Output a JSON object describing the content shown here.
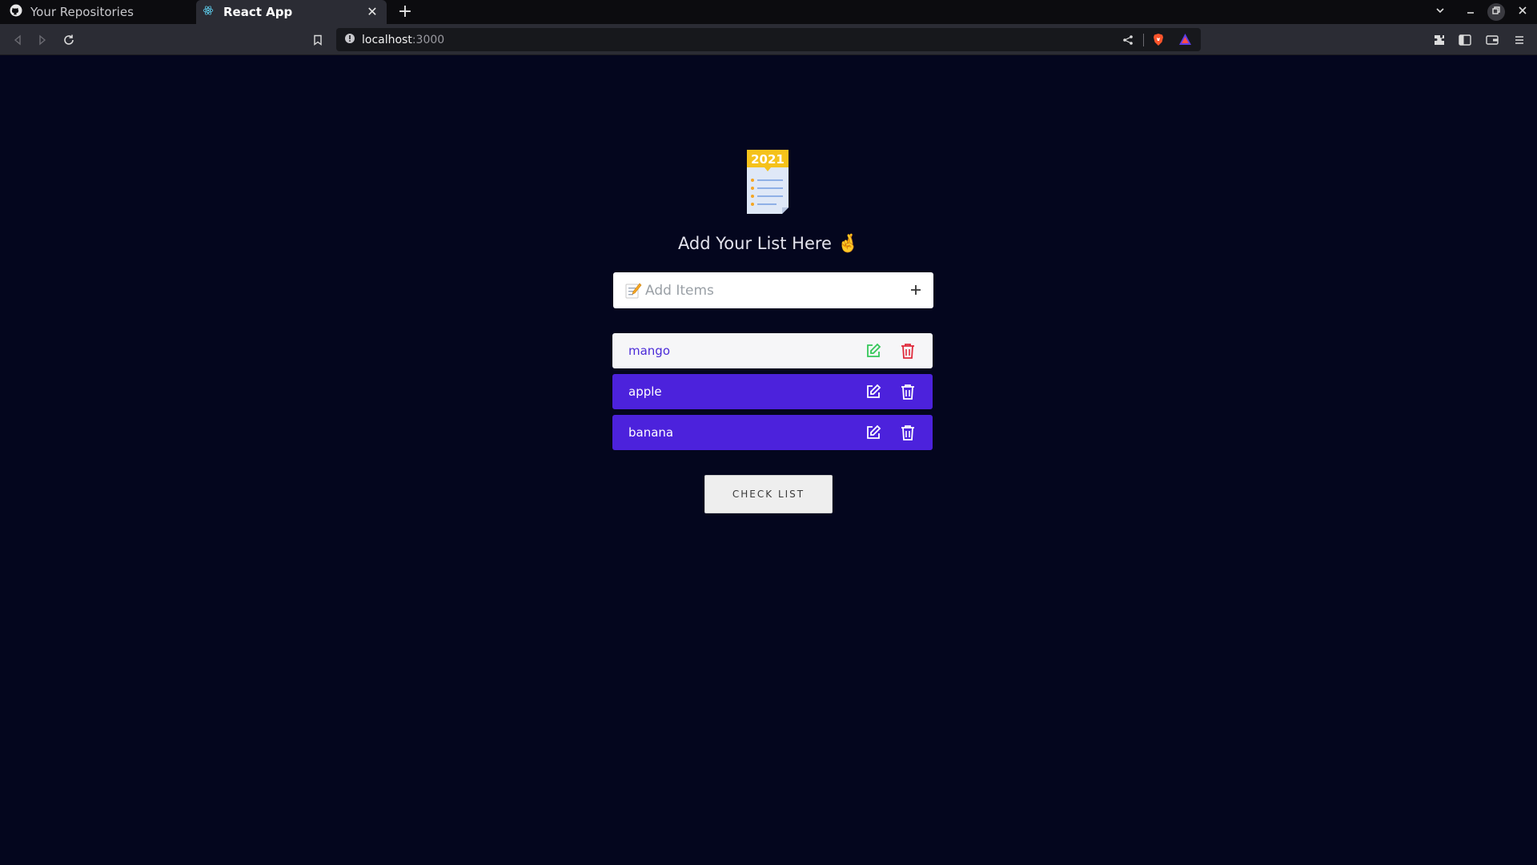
{
  "browser": {
    "tabs": [
      {
        "label": "Your Repositories",
        "icon": "github-icon",
        "active": false
      },
      {
        "label": "React App",
        "icon": "react-icon",
        "active": true
      }
    ],
    "url": {
      "host": "localhost",
      "port": ":3000"
    }
  },
  "app": {
    "logo_year": "2021",
    "heading": "Add Your List Here",
    "heading_emoji": "🤞",
    "input": {
      "placeholder": "Add Items",
      "value": ""
    },
    "items": [
      {
        "label": "mango",
        "style": "highlighted"
      },
      {
        "label": "apple",
        "style": "default"
      },
      {
        "label": "banana",
        "style": "default"
      }
    ],
    "check_button": "CHECK LIST"
  },
  "colors": {
    "background": "#04061e",
    "item_purple": "#4c22dc",
    "edit_green": "#34c759",
    "delete_red": "#e0293a"
  }
}
